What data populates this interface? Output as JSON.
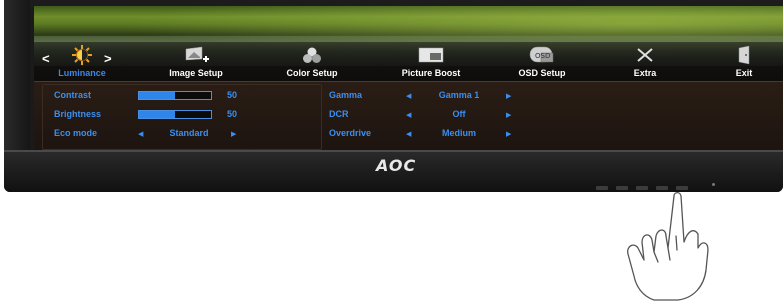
{
  "brand": {
    "logo_text": "AOC"
  },
  "menu": {
    "items": [
      {
        "label": "Luminance",
        "icon": "sun-contrast-icon",
        "active": true
      },
      {
        "label": "Image Setup",
        "icon": "image-setup-icon"
      },
      {
        "label": "Color Setup",
        "icon": "color-setup-icon"
      },
      {
        "label": "Picture Boost",
        "icon": "picture-boost-icon"
      },
      {
        "label": "OSD Setup",
        "icon": "osd-setup-icon"
      },
      {
        "label": "Extra",
        "icon": "extra-icon"
      },
      {
        "label": "Exit",
        "icon": "exit-icon"
      }
    ],
    "nav_left": "<",
    "nav_right": ">"
  },
  "settings_left": {
    "contrast": {
      "label": "Contrast",
      "value": "50",
      "level": 0.5
    },
    "brightness": {
      "label": "Brightness",
      "value": "50",
      "level": 0.5
    },
    "eco_mode": {
      "label": "Eco mode",
      "value": "Standard"
    }
  },
  "settings_right": {
    "gamma": {
      "label": "Gamma",
      "value": "Gamma 1"
    },
    "dcr": {
      "label": "DCR",
      "value": "Off"
    },
    "overdrive": {
      "label": "Overdrive",
      "value": "Medium"
    }
  },
  "colors": {
    "accent": "#3a8ff0",
    "active_label": "#3d86e8",
    "panel_bg": "#221812",
    "bezel": "#1a1a1a"
  }
}
